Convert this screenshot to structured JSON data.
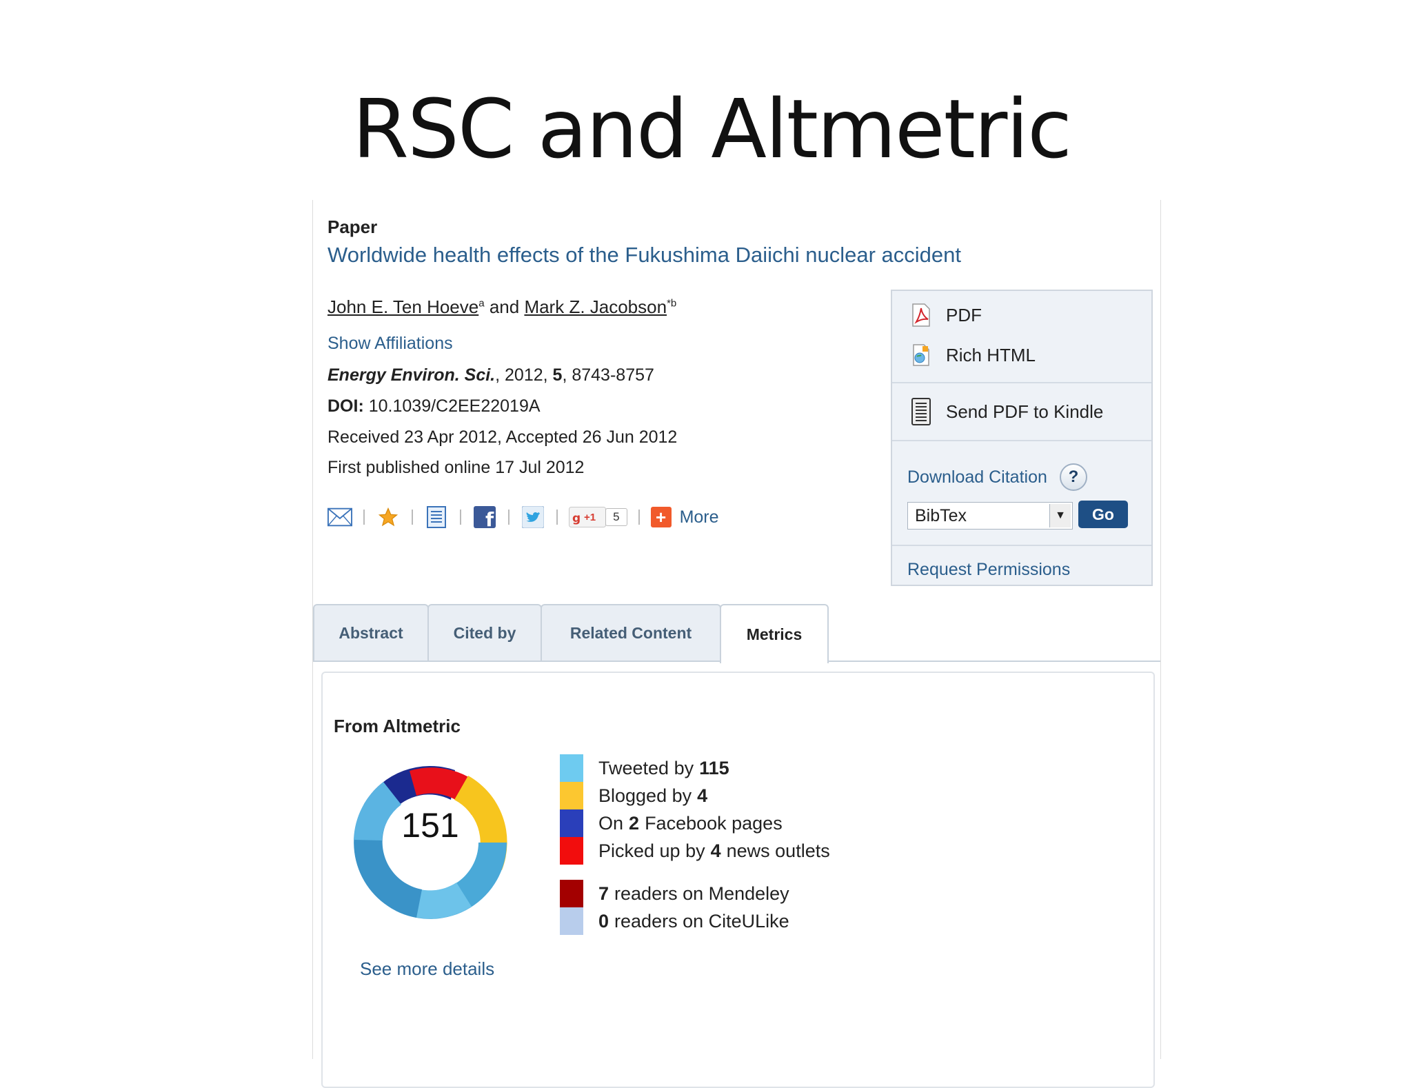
{
  "slide": {
    "title": "RSC and Altmetric"
  },
  "article": {
    "type_label": "Paper",
    "title": "Worldwide health effects of the Fukushima Daiichi nuclear accident",
    "author1": "John E. Ten Hoeve",
    "author1_sup": "a",
    "and": "and",
    "author2": "Mark Z. Jacobson",
    "author2_sup": "*b",
    "show_affiliations": "Show Affiliations",
    "journal": "Energy Environ. Sci.",
    "journal_rest": ", 2012, ",
    "volume": "5",
    "pages": ", 8743-8757",
    "doi_label": "DOI:",
    "doi": " 10.1039/C2EE22019A",
    "received": "Received 23 Apr 2012, Accepted 26 Jun 2012",
    "published": "First published online 17 Jul 2012"
  },
  "share": {
    "gplus_label": "+1",
    "gplus_count": "5",
    "more_label": "More"
  },
  "sidebar": {
    "pdf": "PDF",
    "rich_html": "Rich HTML",
    "kindle": "Send PDF to Kindle",
    "download_citation": "Download Citation",
    "help": "?",
    "format": "BibTex",
    "go": "Go",
    "permissions": "Request Permissions"
  },
  "tabs": [
    {
      "label": "Abstract"
    },
    {
      "label": "Cited by"
    },
    {
      "label": "Related Content"
    },
    {
      "label": "Metrics",
      "active": true
    }
  ],
  "metrics": {
    "heading": "From Altmetric",
    "score": "151",
    "see_more": "See more details",
    "stats": [
      {
        "pre": "Tweeted by",
        "num": "115",
        "post": "",
        "color": "#6ecbf0"
      },
      {
        "pre": "Blogged by",
        "num": "4",
        "post": "",
        "color": "#fcc730"
      },
      {
        "pre": "On",
        "num": "2",
        "post": "Facebook pages",
        "color": "#2a3fba"
      },
      {
        "pre": "Picked up by",
        "num": "4",
        "post": "news outlets",
        "color": "#f20d0d"
      },
      {
        "pre": "",
        "num": "7",
        "post": "readers on Mendeley",
        "color": "#a30000"
      },
      {
        "pre": "",
        "num": "0",
        "post": "readers on CiteULike",
        "color": "#b8cdec"
      }
    ]
  }
}
